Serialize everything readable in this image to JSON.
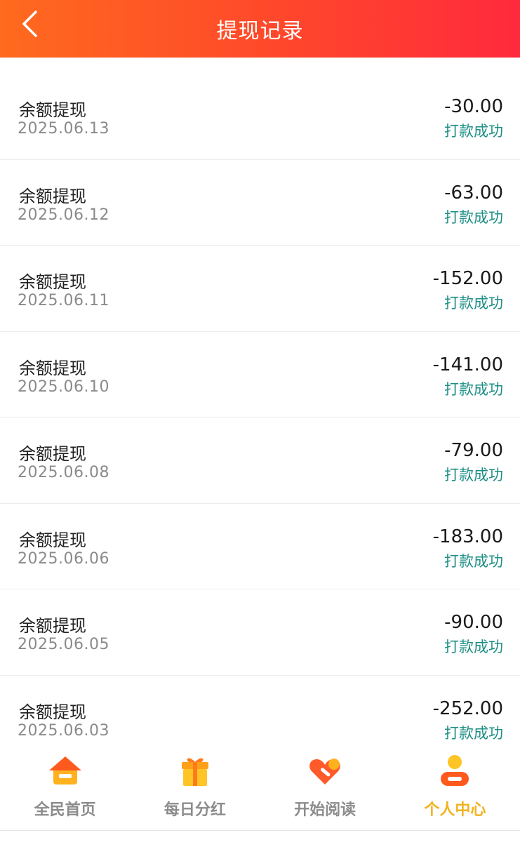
{
  "header": {
    "title": "提现记录",
    "back_icon": "chevron-left-icon"
  },
  "records": [
    {
      "title": "余额提现",
      "date": "2025.06.13",
      "amount": "-30.00",
      "status": "打款成功"
    },
    {
      "title": "余额提现",
      "date": "2025.06.12",
      "amount": "-63.00",
      "status": "打款成功"
    },
    {
      "title": "余额提现",
      "date": "2025.06.11",
      "amount": "-152.00",
      "status": "打款成功"
    },
    {
      "title": "余额提现",
      "date": "2025.06.10",
      "amount": "-141.00",
      "status": "打款成功"
    },
    {
      "title": "余额提现",
      "date": "2025.06.08",
      "amount": "-79.00",
      "status": "打款成功"
    },
    {
      "title": "余额提现",
      "date": "2025.06.06",
      "amount": "-183.00",
      "status": "打款成功"
    },
    {
      "title": "余额提现",
      "date": "2025.06.05",
      "amount": "-90.00",
      "status": "打款成功"
    },
    {
      "title": "余额提现",
      "date": "2025.06.03",
      "amount": "-252.00",
      "status": "打款成功"
    }
  ],
  "tabbar": {
    "tabs": [
      {
        "label": "全民首页",
        "icon": "home-icon",
        "active": false
      },
      {
        "label": "每日分红",
        "icon": "gift-icon",
        "active": false
      },
      {
        "label": "开始阅读",
        "icon": "heart-icon",
        "active": false
      },
      {
        "label": "个人中心",
        "icon": "user-icon",
        "active": true
      }
    ]
  },
  "colors": {
    "header_start": "#ff6a1e",
    "header_end": "#ff2a3c",
    "status_text": "#1e8f86",
    "tab_active": "#f2b21c",
    "tab_inactive": "#8c8c8c"
  }
}
